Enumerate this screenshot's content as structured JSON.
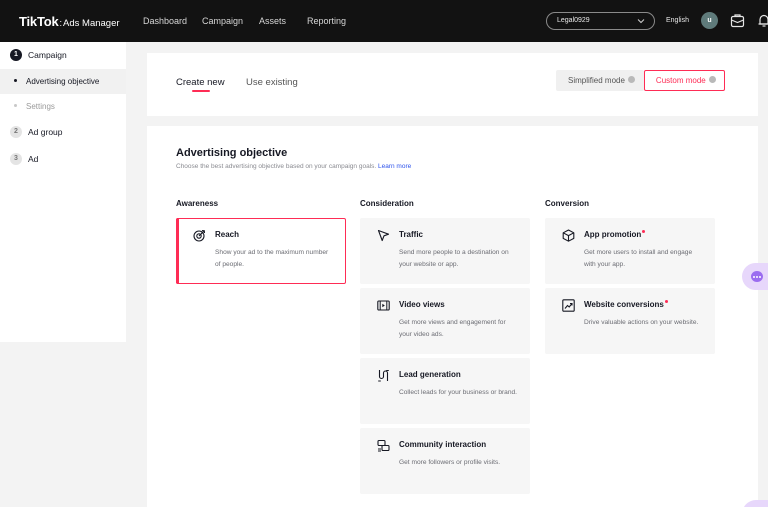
{
  "header": {
    "logo_main": "TikTok",
    "logo_sep": ":",
    "logo_sub": "Ads Manager",
    "nav": [
      "Dashboard",
      "Campaign",
      "Assets",
      "Reporting"
    ],
    "account": "Legal0929",
    "language": "English",
    "avatar_letter": "u"
  },
  "sidebar": {
    "steps": [
      {
        "num": "1",
        "label": "Campaign",
        "active": true
      },
      {
        "num": "2",
        "label": "Ad group",
        "active": false
      },
      {
        "num": "3",
        "label": "Ad",
        "active": false
      }
    ],
    "sub_items": [
      {
        "label": "Advertising objective",
        "active": true
      },
      {
        "label": "Settings",
        "active": false
      }
    ]
  },
  "tabs": {
    "create_new": "Create new",
    "use_existing": "Use existing"
  },
  "modes": {
    "simplified": "Simplified mode",
    "custom": "Custom mode"
  },
  "objective": {
    "title": "Advertising objective",
    "subtitle": "Choose the best advertising objective based on your campaign goals.",
    "link": "Learn more",
    "columns": {
      "awareness": "Awareness",
      "consideration": "Consideration",
      "conversion": "Conversion"
    },
    "options": {
      "reach": {
        "title": "Reach",
        "desc": "Show your ad to the maximum number of people."
      },
      "traffic": {
        "title": "Traffic",
        "desc": "Send more people to a destination on your website or app."
      },
      "video_views": {
        "title": "Video views",
        "desc": "Get more views and engagement for your video ads."
      },
      "lead_generation": {
        "title": "Lead generation",
        "desc": "Collect leads for your business or brand."
      },
      "community_interaction": {
        "title": "Community interaction",
        "desc": "Get more followers or profile visits."
      },
      "app_promotion": {
        "title": "App promotion",
        "desc": "Get more users to install and engage with your app."
      },
      "website_conversions": {
        "title": "Website conversions",
        "desc": "Drive valuable actions on your website."
      }
    }
  },
  "colors": {
    "accent": "#fe2c55",
    "topbar": "#121212",
    "link": "#2f54eb"
  }
}
